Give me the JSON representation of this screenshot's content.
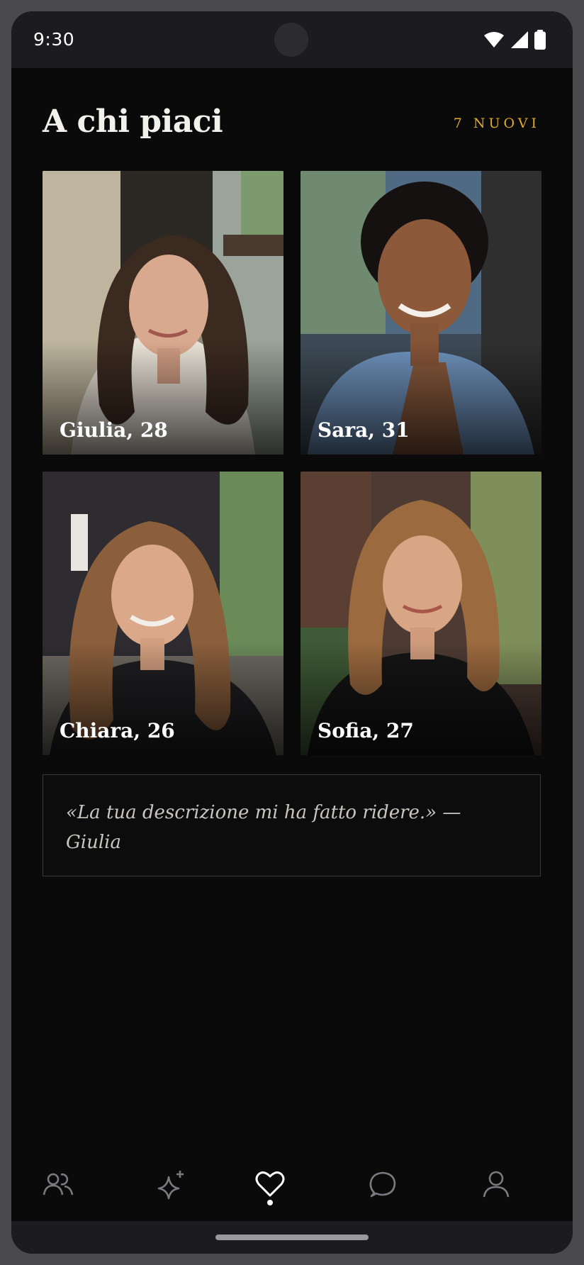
{
  "status_bar": {
    "time": "9:30",
    "icons": [
      "wifi-icon",
      "signal-icon",
      "battery-icon"
    ]
  },
  "header": {
    "title": "A chi piaci",
    "badge": "7 NUOVI"
  },
  "profiles": [
    {
      "name": "Giulia, 28"
    },
    {
      "name": "Sara, 31"
    },
    {
      "name": "Chiara, 26"
    },
    {
      "name": "Sofia, 27"
    }
  ],
  "quote": {
    "text": "«La tua descrizione mi ha fatto ridere.» — Giulia"
  },
  "nav": {
    "items": [
      "people-icon",
      "sparkle-icon",
      "heart-icon",
      "chat-icon",
      "profile-icon"
    ],
    "active": "heart-icon"
  },
  "colors": {
    "background": "#0a0a0a",
    "accent": "#e0a92c",
    "text": "#f3f1ec"
  }
}
